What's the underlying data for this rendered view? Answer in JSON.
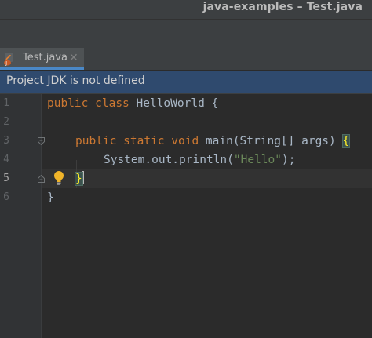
{
  "window": {
    "title": "java-examples – Test.java"
  },
  "tabs": [
    {
      "label": "Test.java",
      "close": "✕",
      "active": true
    }
  ],
  "banner": {
    "text": "Project JDK is not defined"
  },
  "editor": {
    "current_line": 5,
    "line_numbers": [
      "1",
      "2",
      "3",
      "4",
      "5",
      "6"
    ],
    "lines": {
      "l1": {
        "kw1": "public",
        "kw2": "class",
        "rest": "HelloWorld {"
      },
      "l3": {
        "kw1": "public",
        "kw2": "static",
        "kw3": "void",
        "rest": "main(String[] args) ",
        "brace": "{"
      },
      "l4": {
        "prefix": "System.out.println(",
        "string": "\"Hello\"",
        "suffix": ");"
      },
      "l5": {
        "brace": "}"
      },
      "l6": {
        "text": "}"
      }
    }
  },
  "colors": {
    "keyword": "#cc7832",
    "string": "#6a8759",
    "text": "#a9b7c6",
    "banner_bg": "#2f4a6e",
    "brace_highlight": "#ffef28"
  },
  "icons": {
    "tab_file": "java-file-icon",
    "fold_open": "fold-open-icon",
    "fold_close": "fold-close-icon",
    "intention": "lightbulb-icon"
  }
}
